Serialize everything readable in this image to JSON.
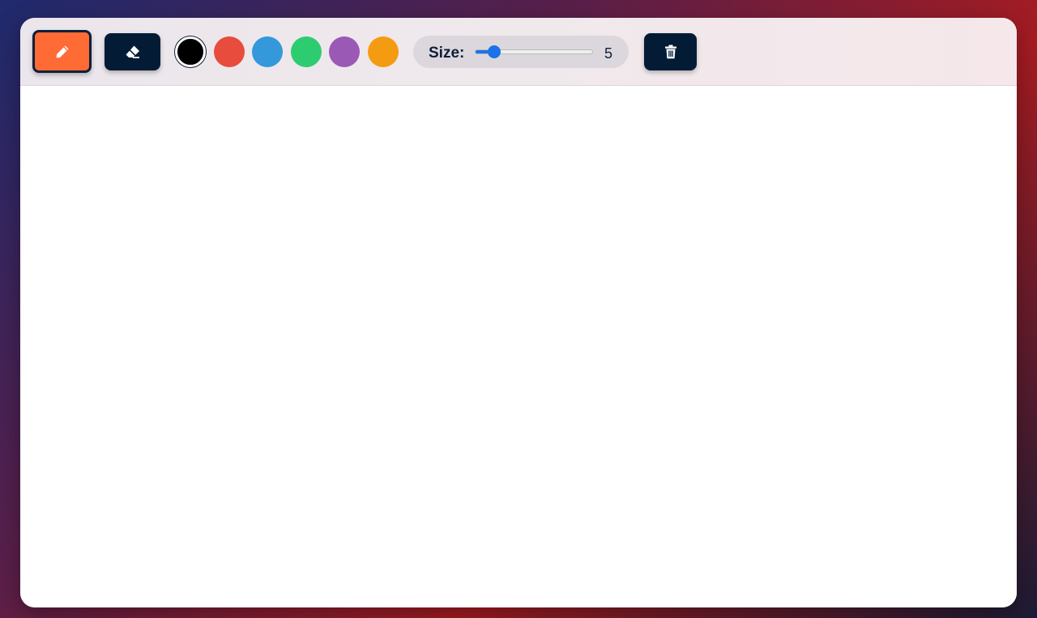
{
  "toolbar": {
    "tools": [
      {
        "name": "pen",
        "icon": "pencil-icon",
        "active": true,
        "color": "#ff6b35"
      },
      {
        "name": "eraser",
        "icon": "eraser-icon",
        "active": false,
        "color": "#041b36"
      }
    ],
    "palette": [
      {
        "color": "#000000",
        "selected": true
      },
      {
        "color": "#e74c3c",
        "selected": false
      },
      {
        "color": "#3498db",
        "selected": false
      },
      {
        "color": "#2ecc71",
        "selected": false
      },
      {
        "color": "#9b59b6",
        "selected": false
      },
      {
        "color": "#f39c12",
        "selected": false
      }
    ],
    "size": {
      "label": "Size:",
      "value": "5",
      "min": 1,
      "max": 50
    },
    "clear": {
      "icon": "trash-icon"
    }
  },
  "colors": {
    "accent": "#ff6b35",
    "button_dark": "#041b36",
    "slider": "#1a73e8"
  }
}
